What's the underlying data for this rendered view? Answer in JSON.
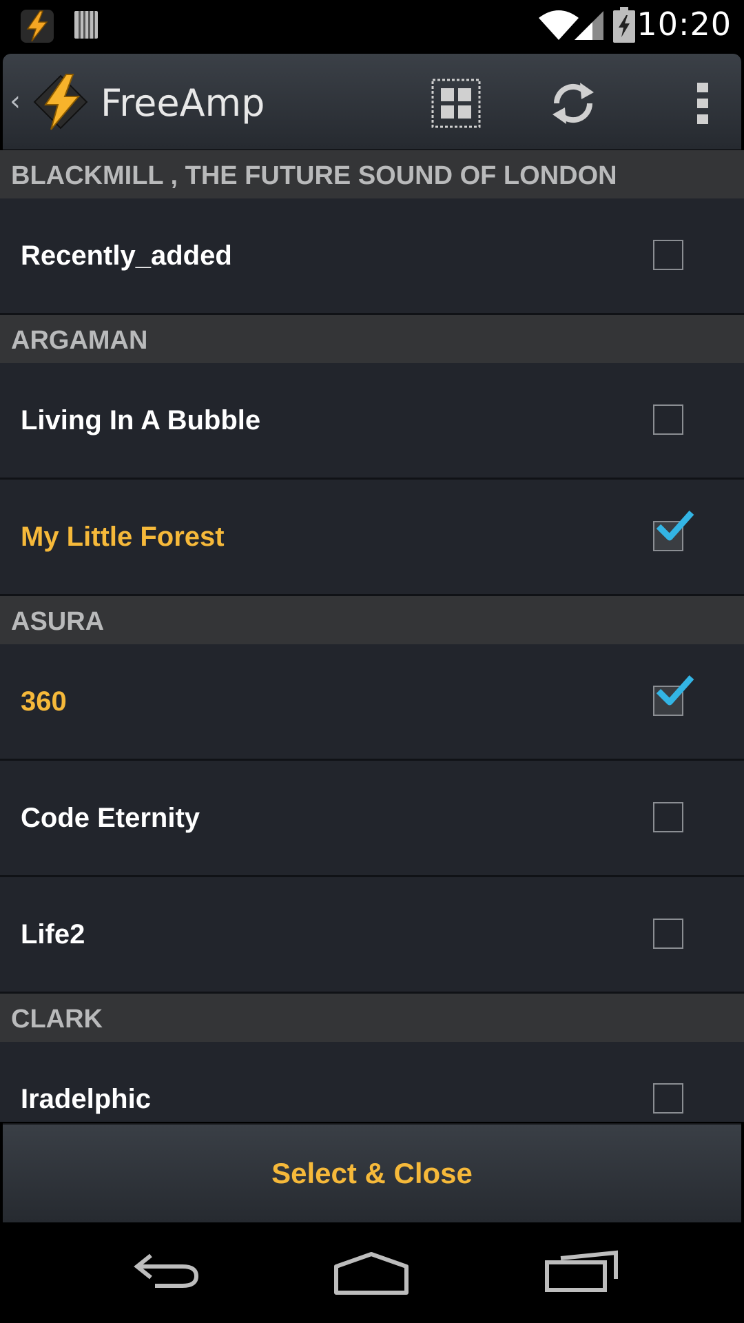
{
  "status_bar": {
    "time": "10:20"
  },
  "action_bar": {
    "title": "FreeAmp"
  },
  "list": {
    "sections": [
      {
        "header": "BLACKMILL , THE FUTURE SOUND OF LONDON",
        "items": [
          {
            "label": "Recently_added",
            "checked": false
          }
        ]
      },
      {
        "header": "ARGAMAN",
        "items": [
          {
            "label": "Living In A Bubble",
            "checked": false
          },
          {
            "label": "My Little Forest",
            "checked": true
          }
        ]
      },
      {
        "header": "ASURA",
        "items": [
          {
            "label": "360",
            "checked": true
          },
          {
            "label": "Code Eternity",
            "checked": false
          },
          {
            "label": "Life2",
            "checked": false
          }
        ]
      },
      {
        "header": "CLARK",
        "items": [
          {
            "label": "Iradelphic",
            "checked": false
          }
        ]
      }
    ]
  },
  "footer": {
    "button_label": "Select & Close"
  },
  "colors": {
    "accent": "#f6b93a",
    "check": "#33b5e5",
    "list_bg": "#22252c",
    "header_bg": "#343537"
  },
  "icons": {
    "status": [
      "app-bolt-icon",
      "storage-icon",
      "wifi-icon",
      "signal-icon",
      "battery-charging-icon"
    ],
    "action_bar": [
      "up-arrow-icon",
      "app-logo-icon",
      "grid-view-icon",
      "sync-icon",
      "overflow-menu-icon"
    ],
    "nav": [
      "back-icon",
      "home-icon",
      "recents-icon"
    ]
  }
}
